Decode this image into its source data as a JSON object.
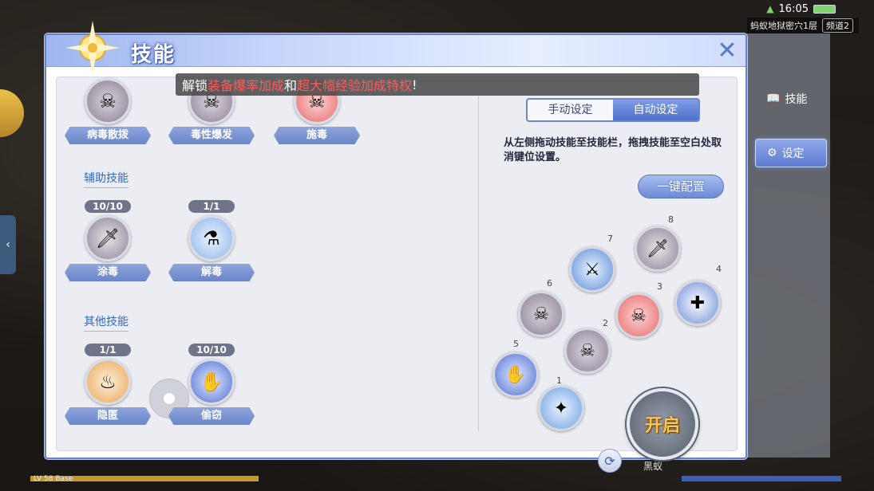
{
  "status": {
    "time": "16:05",
    "map": "蚂蚁地狱密穴1层",
    "channel": "频道2"
  },
  "panel": {
    "title": "技能",
    "notice": {
      "prefix": "解锁",
      "hl1": "装备爆率加成",
      "mid": "和",
      "hl2": "超大幅经验加成特权",
      "suffix": "!"
    }
  },
  "skills": {
    "top": [
      {
        "name": "病毒散拨",
        "icon": "skull-icon"
      },
      {
        "name": "毒性爆发",
        "icon": "poison-burst-icon"
      },
      {
        "name": "施毒",
        "icon": "toxic-skull-icon"
      }
    ],
    "support_title": "辅助技能",
    "support": [
      {
        "level": "10/10",
        "name": "涂毒",
        "icon": "poison-dagger-icon"
      },
      {
        "level": "1/1",
        "name": "解毒",
        "icon": "antidote-flask-icon"
      }
    ],
    "other_title": "其他技能",
    "other": [
      {
        "level": "1/1",
        "name": "隐匿",
        "icon": "hide-icon"
      },
      {
        "level": "10/10",
        "name": "偷窃",
        "icon": "steal-hand-icon"
      }
    ]
  },
  "right": {
    "mode_manual": "手动设定",
    "mode_auto": "自动设定",
    "instructions": "从左侧拖动技能至技能栏，拖拽技能至空白处取消键位设置。",
    "one_key": "一键配置",
    "slots": [
      "1",
      "2",
      "3",
      "4",
      "5",
      "6",
      "7",
      "8"
    ],
    "start_label": "开启"
  },
  "hud": {
    "skills_tab": "技能",
    "settings_tab": "设定",
    "bottom_name": "黑蚁",
    "level_label": "LV 58 Base"
  },
  "colors": {
    "accent": "#6b86c8",
    "notice_highlight": "#ff5a5a",
    "start_text": "#f6c85a"
  }
}
